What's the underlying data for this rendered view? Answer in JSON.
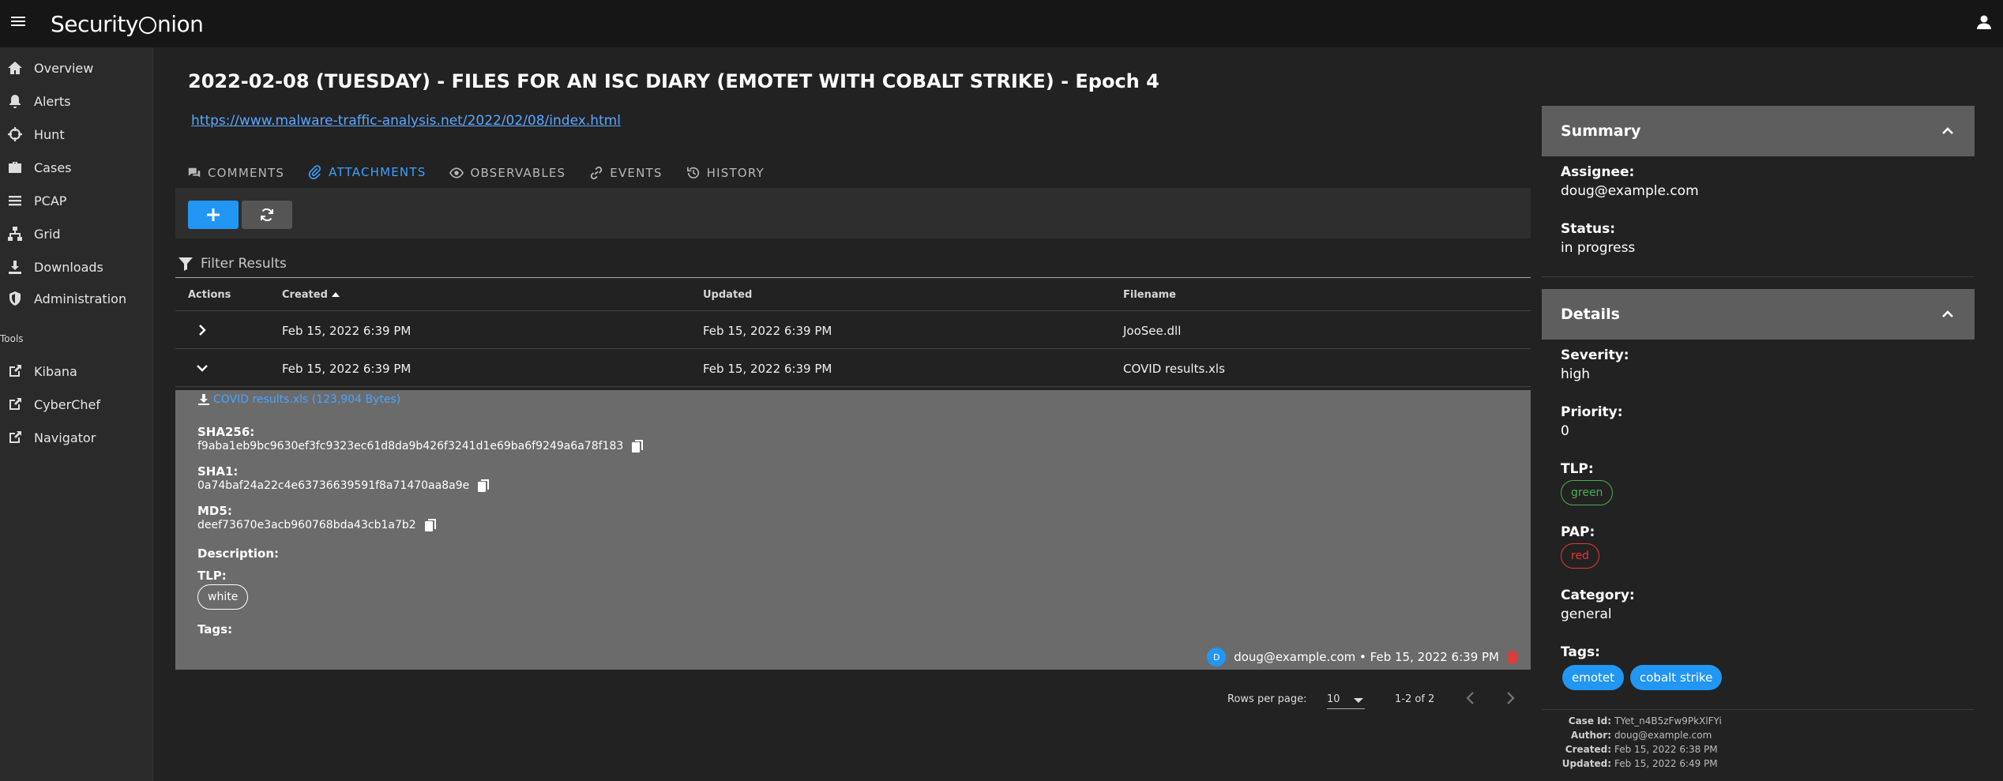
{
  "app": {
    "logo_text": "Security",
    "logo_text_tail": "nion"
  },
  "sidebar": {
    "items": [
      {
        "label": "Overview",
        "icon": "home-icon"
      },
      {
        "label": "Alerts",
        "icon": "bell-icon"
      },
      {
        "label": "Hunt",
        "icon": "crosshair-icon"
      },
      {
        "label": "Cases",
        "icon": "briefcase-icon"
      },
      {
        "label": "PCAP",
        "icon": "list-icon"
      },
      {
        "label": "Grid",
        "icon": "network-icon"
      },
      {
        "label": "Downloads",
        "icon": "download-icon"
      },
      {
        "label": "Administration",
        "icon": "shield-icon"
      }
    ],
    "tools_label": "Tools",
    "tools": [
      {
        "label": "Kibana",
        "icon": "external-link-icon"
      },
      {
        "label": "CyberChef",
        "icon": "external-link-icon"
      },
      {
        "label": "Navigator",
        "icon": "external-link-icon"
      }
    ]
  },
  "case": {
    "title": "2022-02-08 (TUESDAY) - FILES FOR AN ISC DIARY (EMOTET WITH COBALT STRIKE) - Epoch 4",
    "link": "https://www.malware-traffic-analysis.net/2022/02/08/index.html"
  },
  "tabs": [
    {
      "label": "COMMENTS",
      "icon": "comments-icon"
    },
    {
      "label": "ATTACHMENTS",
      "icon": "paperclip-icon",
      "active": true
    },
    {
      "label": "OBSERVABLES",
      "icon": "eye-icon"
    },
    {
      "label": "EVENTS",
      "icon": "link-icon"
    },
    {
      "label": "HISTORY",
      "icon": "history-icon"
    }
  ],
  "filter": {
    "placeholder": "Filter Results"
  },
  "table": {
    "headers": {
      "actions": "Actions",
      "created": "Created",
      "updated": "Updated",
      "filename": "Filename"
    },
    "rows": [
      {
        "created": "Feb 15, 2022 6:39 PM",
        "updated": "Feb 15, 2022 6:39 PM",
        "filename": "JooSee.dll",
        "expanded": false
      },
      {
        "created": "Feb 15, 2022 6:39 PM",
        "updated": "Feb 15, 2022 6:39 PM",
        "filename": "COVID results.xls",
        "expanded": true
      }
    ]
  },
  "attachment": {
    "download_label": "COVID results.xls (123,904 Bytes)",
    "sha256_label": "SHA256:",
    "sha256": "f9aba1eb9bc9630ef3fc9323ec61d8da9b426f3241d1e69ba6f9249a6a78f183",
    "sha1_label": "SHA1:",
    "sha1": "0a74baf24a22c4e63736639591f8a71470aa8a9e",
    "md5_label": "MD5:",
    "md5": "deef73670e3acb960768bda43cb1a7b2",
    "description_label": "Description:",
    "tlp_label": "TLP:",
    "tlp": "white",
    "tags_label": "Tags:",
    "avatar_letter": "D",
    "author_line": "doug@example.com • Feb 15, 2022 6:39 PM"
  },
  "pagination": {
    "rows_per_page_label": "Rows per page:",
    "rows_per_page": "10",
    "range": "1-2 of 2"
  },
  "summary": {
    "title": "Summary",
    "assignee_label": "Assignee:",
    "assignee": "doug@example.com",
    "status_label": "Status:",
    "status": "in progress"
  },
  "details": {
    "title": "Details",
    "severity_label": "Severity:",
    "severity": "high",
    "priority_label": "Priority:",
    "priority": "0",
    "tlp_label": "TLP:",
    "tlp": "green",
    "pap_label": "PAP:",
    "pap": "red",
    "category_label": "Category:",
    "category": "general",
    "tags_label": "Tags:",
    "tags": [
      "emotet",
      "cobalt strike"
    ]
  },
  "meta": {
    "case_id_label": "Case Id:",
    "case_id": "TYet_n4B5zFw9PkXlFYi",
    "author_label": "Author:",
    "author": "doug@example.com",
    "created_label": "Created:",
    "created": "Feb 15, 2022 6:38 PM",
    "updated_label": "Updated:",
    "updated": "Feb 15, 2022 6:49 PM"
  },
  "colors": {
    "accent": "#2196f3",
    "tlp_green": "#4caf50",
    "pap_red": "#e53935",
    "delete": "#e53935"
  }
}
